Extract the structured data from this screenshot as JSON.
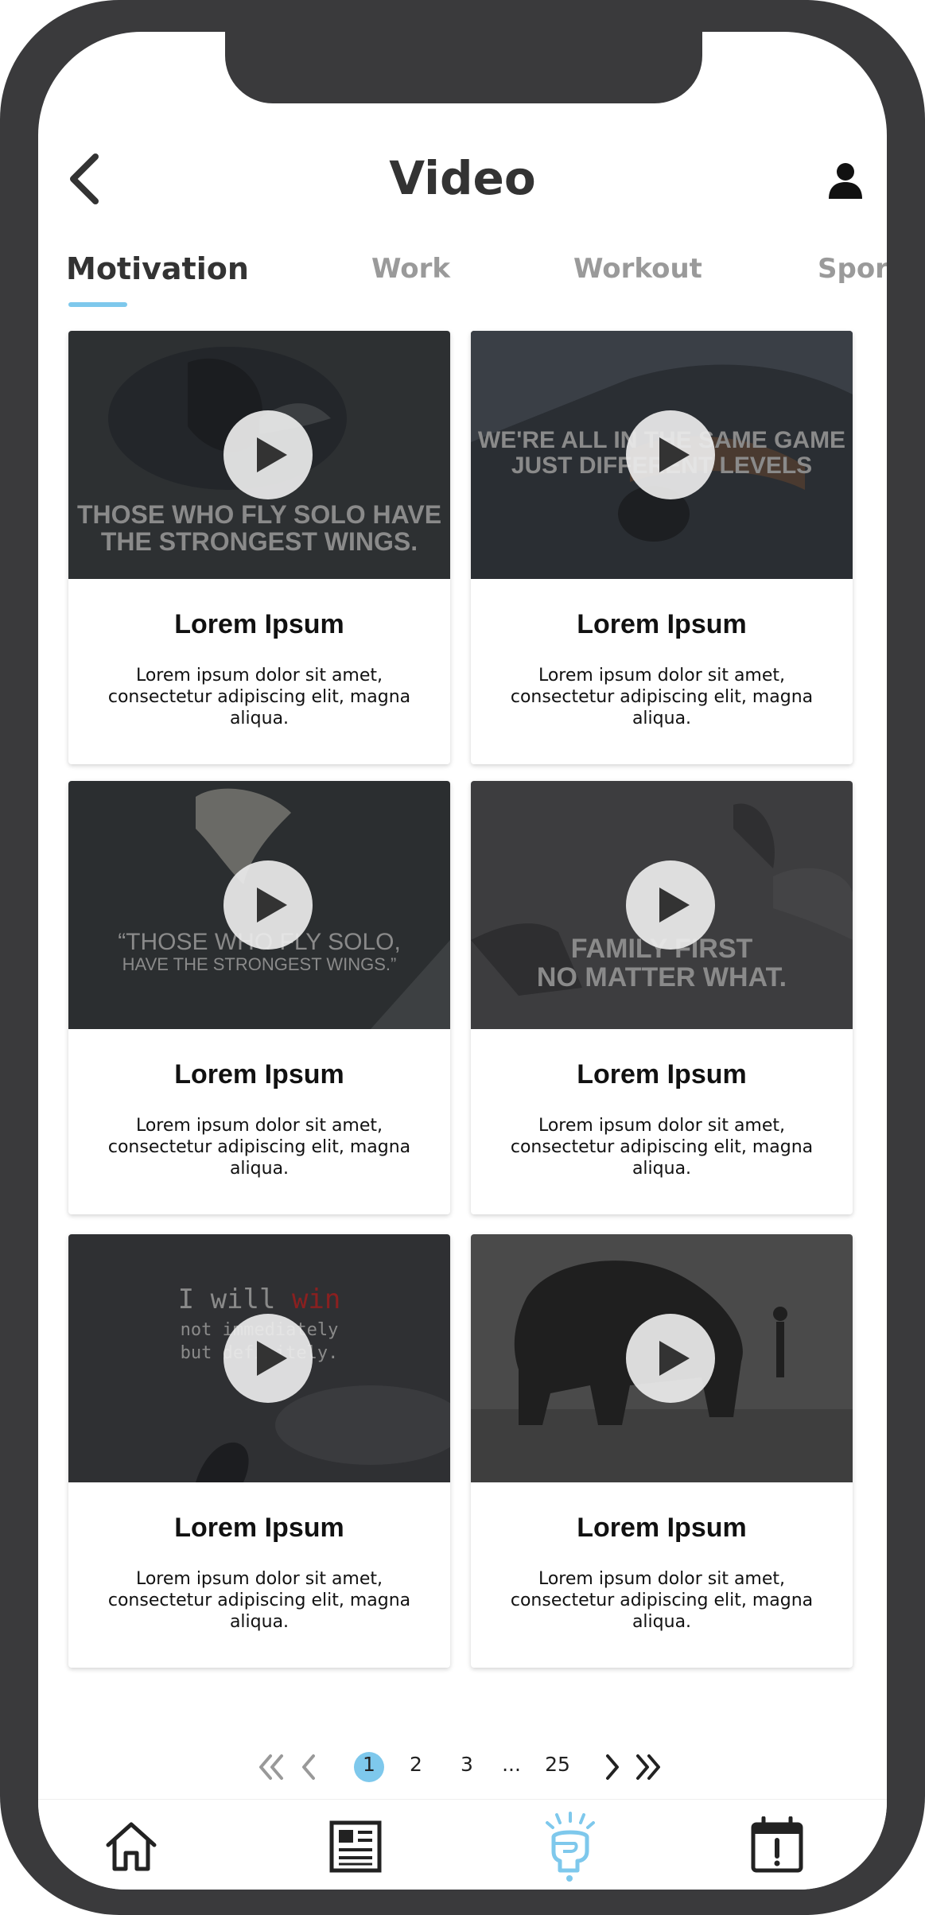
{
  "header": {
    "title": "Video"
  },
  "tabs": [
    {
      "label": "Motivation",
      "active": true
    },
    {
      "label": "Work",
      "active": false
    },
    {
      "label": "Workout",
      "active": false
    },
    {
      "label": "Sport",
      "active": false
    }
  ],
  "cards": [
    {
      "title": "Lorem Ipsum",
      "description": "Lorem ipsum dolor sit amet, consectetur adipiscing elit, magna aliqua.",
      "overlay": [
        "THOSE WHO FLY SOLO HAVE",
        "THE STRONGEST WINGS."
      ]
    },
    {
      "title": "Lorem Ipsum",
      "description": "Lorem ipsum dolor sit amet, consectetur adipiscing elit, magna aliqua.",
      "overlay": [
        "WE'RE ALL IN THE SAME GAME",
        "JUST DIFFERENT LEVELS"
      ]
    },
    {
      "title": "Lorem Ipsum",
      "description": "Lorem ipsum dolor sit amet, consectetur adipiscing elit, magna aliqua.",
      "overlay": [
        "“THOSE WHO FLY SOLO,",
        "HAVE THE STRONGEST WINGS.”"
      ]
    },
    {
      "title": "Lorem Ipsum",
      "description": "Lorem ipsum dolor sit amet, consectetur adipiscing elit, magna aliqua.",
      "overlay": [
        "FAMILY FIRST",
        "NO MATTER WHAT."
      ]
    },
    {
      "title": "Lorem Ipsum",
      "description": "Lorem ipsum dolor sit amet, consectetur adipiscing elit, magna aliqua.",
      "overlay": [
        "I will ",
        "win",
        "not immediately",
        "but definitely."
      ]
    },
    {
      "title": "Lorem Ipsum",
      "description": "Lorem ipsum dolor sit amet, consectetur adipiscing elit, magna aliqua.",
      "overlay": []
    }
  ],
  "pagination": {
    "pages": [
      "1",
      "2",
      "3",
      "...",
      "25"
    ],
    "current": "1"
  },
  "bottom_nav": [
    {
      "icon": "home-icon",
      "active": false
    },
    {
      "icon": "newspaper-icon",
      "active": false
    },
    {
      "icon": "fist-icon",
      "active": true
    },
    {
      "icon": "calendar-alert-icon",
      "active": false
    }
  ],
  "colors": {
    "accent": "#7ec8ec",
    "frame": "#3a3a3c",
    "text": "#333333",
    "tab_inactive": "#9a9a9a"
  }
}
